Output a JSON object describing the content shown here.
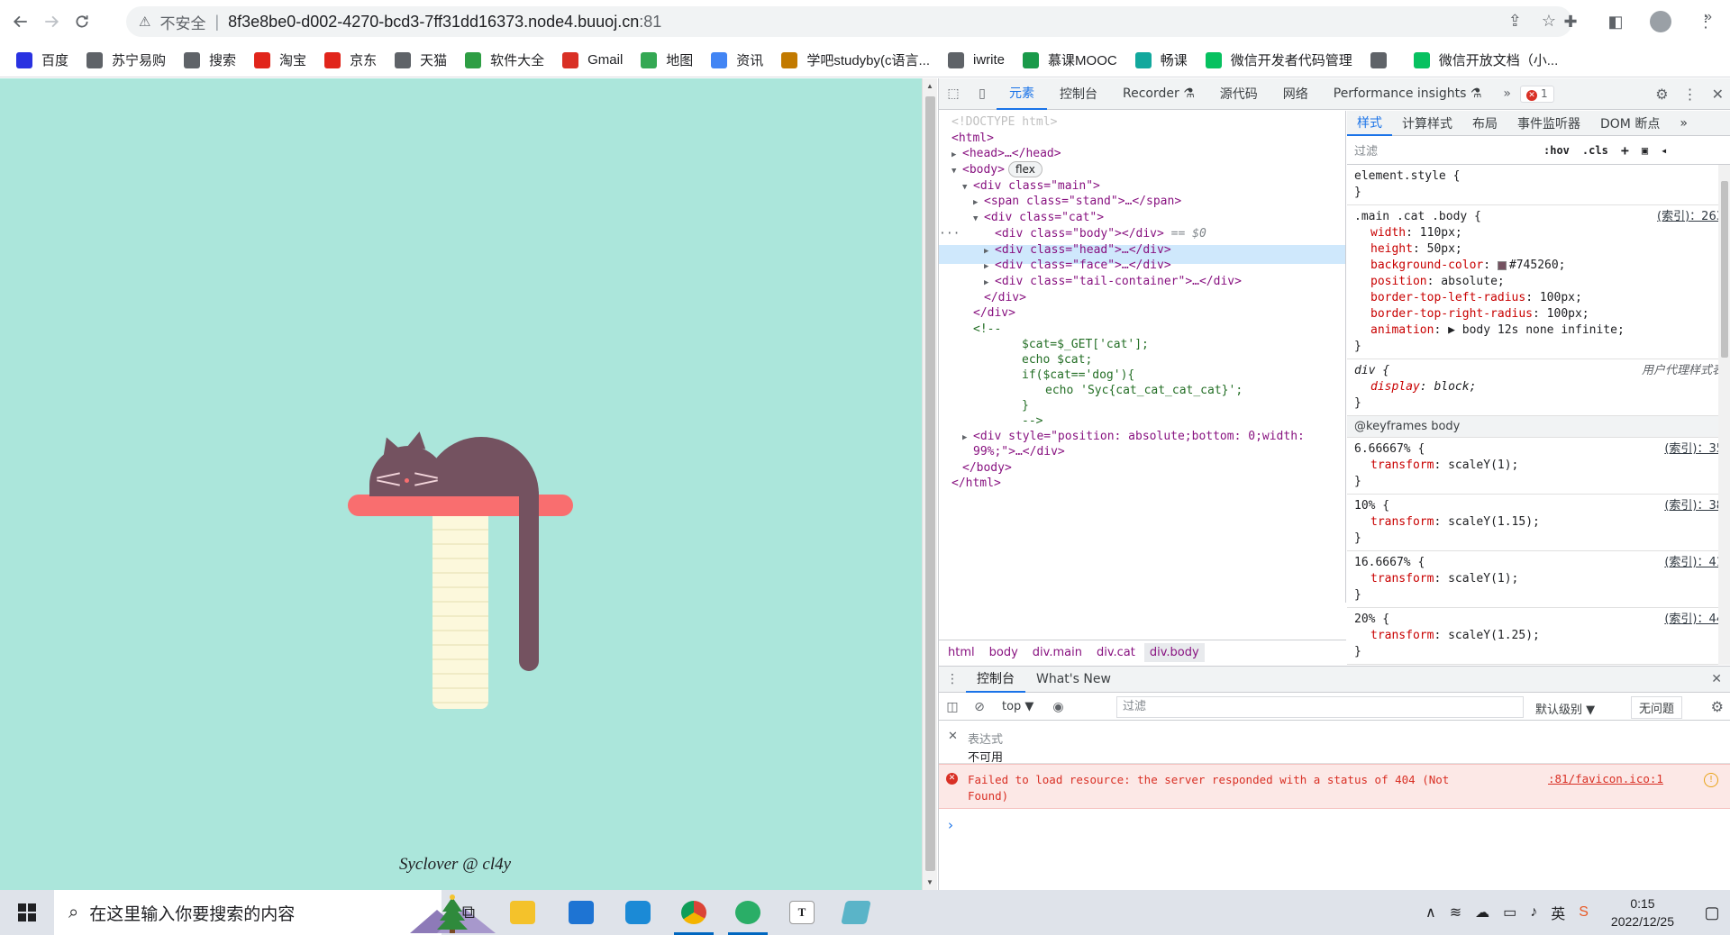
{
  "browser": {
    "insecure_label": "不安全",
    "url_host": "8f3e8be0-d002-4270-bcd3-7ff31dd16373.node4.buuoj.cn",
    "url_port": ":81"
  },
  "bookmarks": [
    {
      "label": "百度",
      "icon": "baidu-icon",
      "color": "#2932e1"
    },
    {
      "label": "苏宁易购",
      "icon": "globe-icon",
      "color": "#5f6368"
    },
    {
      "label": "搜索",
      "icon": "globe-icon",
      "color": "#5f6368"
    },
    {
      "label": "淘宝",
      "icon": "taobao-icon",
      "color": "#e1251b"
    },
    {
      "label": "京东",
      "icon": "jd-icon",
      "color": "#e1251b"
    },
    {
      "label": "天猫",
      "icon": "globe-icon",
      "color": "#5f6368"
    },
    {
      "label": "软件大全",
      "icon": "download-icon",
      "color": "#2e9e44"
    },
    {
      "label": "Gmail",
      "icon": "gmail-icon",
      "color": "#d93025"
    },
    {
      "label": "地图",
      "icon": "maps-icon",
      "color": "#34a853"
    },
    {
      "label": "资讯",
      "icon": "news-icon",
      "color": "#4285f4"
    },
    {
      "label": "学吧studyby(c语言...",
      "icon": "studyby-icon",
      "color": "#c27a00"
    },
    {
      "label": "iwrite",
      "icon": "globe-icon",
      "color": "#5f6368"
    },
    {
      "label": "慕课MOOC",
      "icon": "mooc-icon",
      "color": "#1a9a4a"
    },
    {
      "label": "畅课",
      "icon": "changke-icon",
      "color": "#12a89d"
    },
    {
      "label": "微信开发者代码管理",
      "icon": "wechat-icon",
      "color": "#07c160"
    },
    {
      "label": "",
      "icon": "globe-icon",
      "color": "#5f6368"
    },
    {
      "label": "微信开放文档（小...",
      "icon": "wechat-icon",
      "color": "#07c160"
    }
  ],
  "page": {
    "signature": "Syclover @ cl4y",
    "colors": {
      "background": "#abe6db",
      "stand": "#f96e6f",
      "post": "#fcf8dc",
      "cat": "#745260"
    }
  },
  "devtools": {
    "tabs": [
      "元素",
      "控制台",
      "Recorder ⚗",
      "源代码",
      "网络",
      "Performance insights ⚗"
    ],
    "active_tab": "元素",
    "error_count": "1",
    "elements": {
      "doctype": "<!DOCTYPE html>",
      "html_open": "<html>",
      "head": "<head>…</head>",
      "body_open": "<body>",
      "flex_badge": "flex",
      "main_open": "<div class=\"main\">",
      "stand": "<span class=\"stand\">…</span>",
      "cat_open": "<div class=\"cat\">",
      "body_div": "<div class=\"body\"></div>",
      "eq0": "== $0",
      "head_div": "<div class=\"head\">…</div>",
      "face_div": "<div class=\"face\">…</div>",
      "tail_div": "<div class=\"tail-container\">…</div>",
      "cat_close": "</div>",
      "main_close": "</div>",
      "comment_open": "<!--",
      "php1": "$cat=$_GET['cat'];",
      "php2": "echo $cat;",
      "php3": "if($cat=='dog'){",
      "php4": "echo 'Syc{cat_cat_cat_cat}';",
      "php5": "}",
      "comment_close": "-->",
      "div_style_1": "<div style=\"position: absolute;bottom: 0;width:",
      "div_style_2": "99%;\">…</div>",
      "body_close": "</body>",
      "html_close": "</html>"
    },
    "breadcrumbs": [
      "html",
      "body",
      "div.main",
      "div.cat",
      "div.body"
    ],
    "styles_tabs": [
      "样式",
      "计算样式",
      "布局",
      "事件监听器",
      "DOM 断点"
    ],
    "filter_placeholder": "过滤",
    "filter_hov": ":hov",
    "filter_cls": ".cls",
    "element_style": "element.style {",
    "rule_close": "}",
    "main_rule": {
      "selector": ".main .cat .body {",
      "source": "(索引)：263",
      "props": [
        {
          "name": "width",
          "value": "110px;"
        },
        {
          "name": "height",
          "value": "50px;"
        },
        {
          "name": "background-color",
          "value": "#745260;"
        },
        {
          "name": "position",
          "value": "absolute;"
        },
        {
          "name": "border-top-left-radius",
          "value": "100px;"
        },
        {
          "name": "border-top-right-radius",
          "value": "100px;"
        },
        {
          "name": "animation",
          "value": "▶ body 12s none infinite;"
        }
      ]
    },
    "ua_rule": {
      "selector": "div {",
      "source": "用户代理样式表",
      "prop": "display",
      "value": "block;"
    },
    "keyframes_header": "@keyframes body",
    "keyframes": [
      {
        "sel": "6.66667% {",
        "source": "(索引)：35",
        "prop": "transform",
        "value": "scaleY(1);"
      },
      {
        "sel": "10% {",
        "source": "(索引)：38",
        "prop": "transform",
        "value": "scaleY(1.15);"
      },
      {
        "sel": "16.6667% {",
        "source": "(索引)：41",
        "prop": "transform",
        "value": "scaleY(1);"
      },
      {
        "sel": "20% {",
        "source": "(索引)：44",
        "prop": "transform",
        "value": "scaleY(1.25);"
      }
    ],
    "console": {
      "drawer_tabs": [
        "控制台",
        "What's New"
      ],
      "context": "top ▼",
      "filter_placeholder": "过滤",
      "level": "默认级别 ▼",
      "no_issues": "无问题",
      "live_expr_label": "表达式",
      "live_expr_value": "不可用",
      "error_msg": "Failed to load resource: the server responded with a status of 404 (Not Found)",
      "error_link": ":81/favicon.ico:1"
    }
  },
  "taskbar": {
    "search_placeholder": "在这里输入你要搜索的内容",
    "time": "0:15",
    "date": "2022/12/25",
    "ime": "英"
  }
}
